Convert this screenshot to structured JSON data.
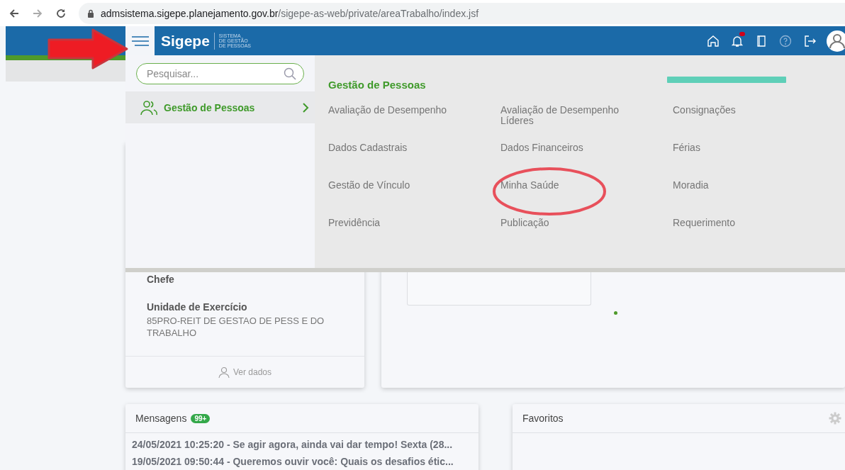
{
  "browser": {
    "url_host": "admsistema.sigepe.planejamento.gov.br",
    "url_path": "/sigepe-as-web/private/areaTrabalho/index.jsf"
  },
  "header": {
    "logo": "Sigepe",
    "subtitle": [
      "SISTEMA",
      "DE GESTÃO",
      "DE PESSOAS"
    ],
    "has_notification": true
  },
  "menu": {
    "search": {
      "placeholder": "Pesquisar..."
    },
    "items": [
      {
        "label": "Gestão de Pessoas",
        "selected": true
      }
    ],
    "section_title": "Gestão de Pessoas",
    "links": [
      "Avaliação de Desempenho",
      "Avaliação de Desempenho Líderes",
      "Consignações",
      "Dados Cadastrais",
      "Dados Financeiros",
      "Férias",
      "Gestão de Vínculo",
      "Minha Saúde",
      "Moradia",
      "Previdência",
      "Publicação",
      "Requerimento"
    ]
  },
  "profile_card": {
    "fields": [
      {
        "label": "Chefe"
      },
      {
        "label": "Unidade de Exercício",
        "value": "85PRO-REIT DE GESTAO DE PESS E DO TRABALHO"
      }
    ],
    "action": "Ver dados"
  },
  "messages": {
    "title": "Mensagens",
    "badge": "99+",
    "items": [
      "24/05/2021 10:25:20 - Se agir agora, ainda vai dar tempo! Sexta (28...",
      "19/05/2021 09:50:44 - Queremos ouvir você: Quais os desafios étic..."
    ]
  },
  "favorites": {
    "title": "Favoritos"
  },
  "annotations": [
    {
      "kind": "arrow"
    },
    {
      "kind": "ellipse"
    }
  ]
}
